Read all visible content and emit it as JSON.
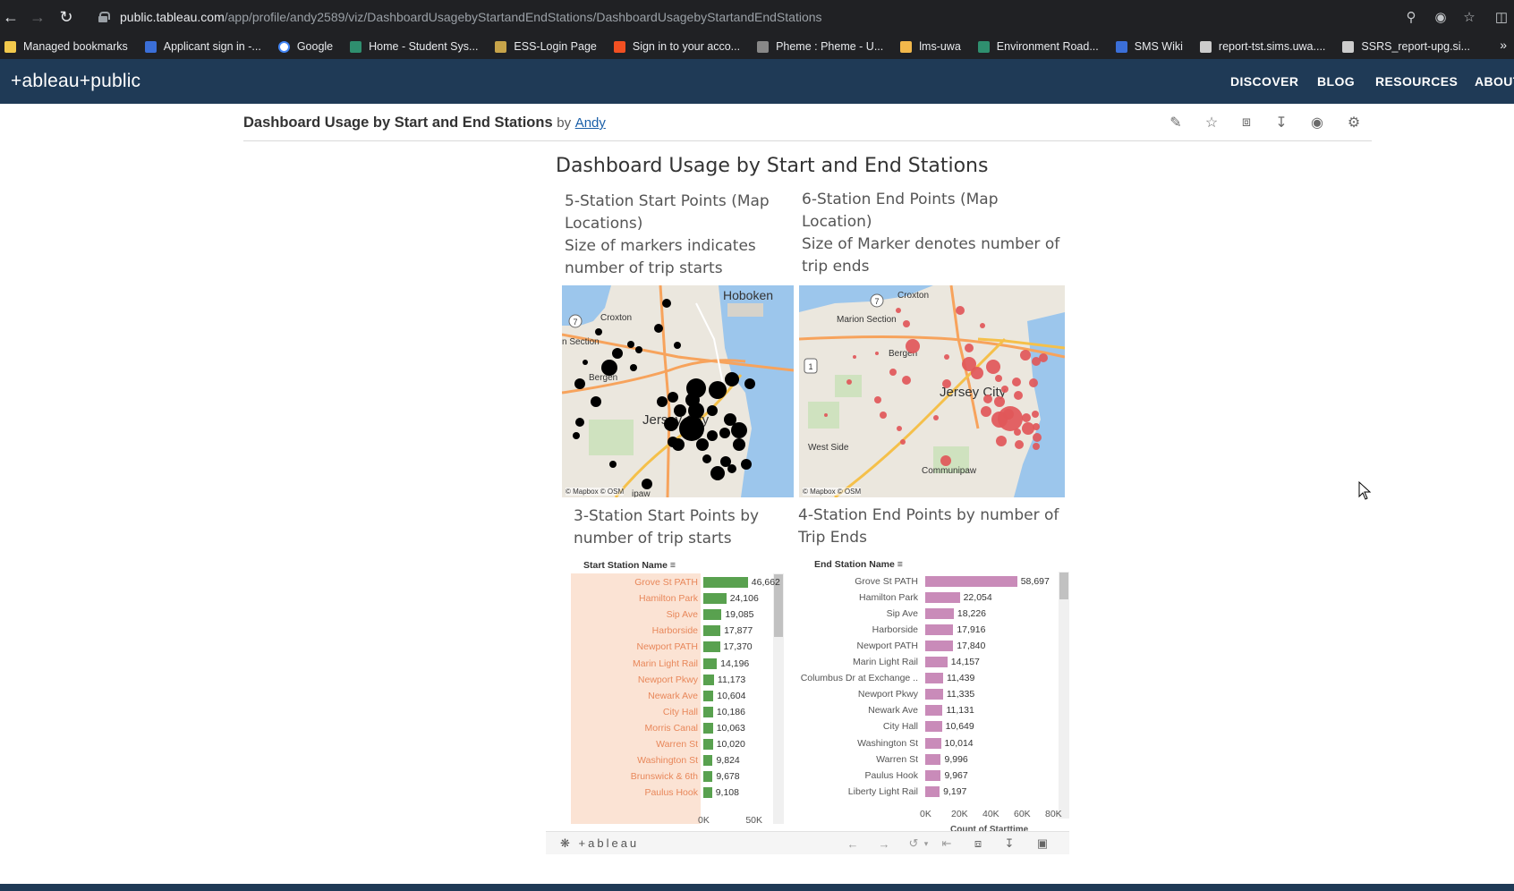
{
  "browser": {
    "url_host": "public.tableau.com",
    "url_path": "/app/profile/andy2589/viz/DashboardUsagebyStartandEndStations/DashboardUsagebyStartandEndStations",
    "bookmarks": [
      {
        "label": "Managed bookmarks",
        "color": "#f2c94c"
      },
      {
        "label": "Applicant sign in -...",
        "color": "#3b6fd8"
      },
      {
        "label": "Google",
        "color": "#ffffff"
      },
      {
        "label": "Home - Student Sys...",
        "color": "#2f8f6f"
      },
      {
        "label": "ESS-Login Page",
        "color": "#c7a44a"
      },
      {
        "label": "Sign in to your acco...",
        "color": "#f25022"
      },
      {
        "label": "Pheme : Pheme - U...",
        "color": "#888888"
      },
      {
        "label": "lms-uwa",
        "color": "#f2b84b"
      },
      {
        "label": "Environment Road...",
        "color": "#2f8f6f"
      },
      {
        "label": "SMS Wiki",
        "color": "#3b6fd8"
      },
      {
        "label": "report-tst.sims.uwa....",
        "color": "#cccccc"
      },
      {
        "label": "SSRS_report-upg.si...",
        "color": "#cccccc"
      }
    ],
    "more_glyph": "»"
  },
  "tableau_header": {
    "logo": "+ableau+public",
    "nav": [
      "DISCOVER",
      "BLOG",
      "RESOURCES",
      "ABOUT"
    ]
  },
  "viz_header": {
    "title": "Dashboard Usage by Start and End Stations",
    "by": "by",
    "author": "Andy"
  },
  "dashboard": {
    "title": "Dashboard Usage by Start and End Stations",
    "sheet5_title": [
      "5-Station Start Points (Map",
      "Locations)",
      "Size of markers indicates",
      "number of trip starts"
    ],
    "sheet6_title": [
      "6-Station End Points (Map",
      "Location)",
      "Size of Marker denotes number of",
      "trip ends"
    ],
    "sheet3_title": [
      "3-Station Start Points by",
      "number of trip starts"
    ],
    "sheet4_title": [
      "4-Station End Points by number of",
      "Trip Ends"
    ],
    "map_credit": "© Mapbox  © OSM",
    "map1_labels": [
      "Hoboken",
      "Croxton",
      "n Section",
      "Bergen",
      "Jersey City",
      "ipaw"
    ],
    "map2_labels": [
      "Croxton",
      "Marion Section",
      "Bergen",
      "Jersey City",
      "West Side",
      "Communipaw"
    ],
    "footer_brand": "+ableau"
  },
  "chart_data": [
    {
      "type": "bar",
      "title": "3-Station Start Points by number of trip starts",
      "field_label": "Start Station Name",
      "categories": [
        "Grove St PATH",
        "Hamilton Park",
        "Sip Ave",
        "Harborside",
        "Newport PATH",
        "Marin Light Rail",
        "Newport Pkwy",
        "Newark Ave",
        "City Hall",
        "Morris Canal",
        "Warren St",
        "Washington St",
        "Brunswick & 6th",
        "Paulus Hook"
      ],
      "values": [
        46662,
        24106,
        19085,
        17877,
        17370,
        14196,
        11173,
        10604,
        10186,
        10063,
        10020,
        9824,
        9678,
        9108
      ],
      "value_labels": [
        "46,662",
        "24,106",
        "19,085",
        "17,877",
        "17,370",
        "14,196",
        "11,173",
        "10,604",
        "10,186",
        "10,063",
        "10,020",
        "9,824",
        "9,678",
        "9,108"
      ],
      "x_ticks": [
        "0K",
        "50K"
      ],
      "xlim": [
        0,
        60000
      ],
      "bar_color": "#59a14f",
      "label_color": "#e8875a"
    },
    {
      "type": "bar",
      "title": "4-Station End Points by number of Trip Ends",
      "field_label": "End Station Name",
      "categories": [
        "Grove St PATH",
        "Hamilton Park",
        "Sip Ave",
        "Harborside",
        "Newport PATH",
        "Marin Light Rail",
        "Columbus Dr at Exchange ..",
        "Newport Pkwy",
        "Newark Ave",
        "City Hall",
        "Washington St",
        "Warren St",
        "Paulus Hook",
        "Liberty Light Rail"
      ],
      "values": [
        58697,
        22054,
        18226,
        17916,
        17840,
        14157,
        11439,
        11335,
        11131,
        10649,
        10014,
        9996,
        9967,
        9197
      ],
      "value_labels": [
        "58,697",
        "22,054",
        "18,226",
        "17,916",
        "17,840",
        "14,157",
        "11,439",
        "11,335",
        "11,131",
        "10,649",
        "10,014",
        "9,996",
        "9,967",
        "9,197"
      ],
      "x_ticks": [
        "0K",
        "20K",
        "40K",
        "60K",
        "80K"
      ],
      "xlim": [
        0,
        80000
      ],
      "xlabel": "Count of Starttime",
      "bar_color": "#c98bb9",
      "label_color": "#555555"
    }
  ]
}
